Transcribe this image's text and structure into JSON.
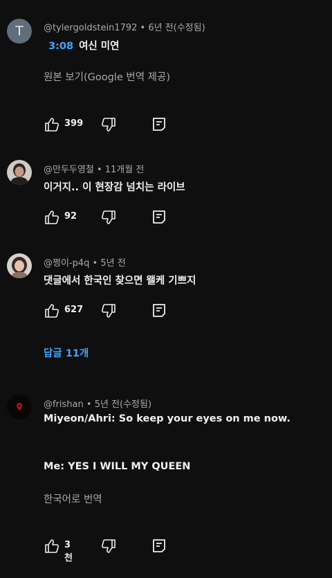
{
  "comments": [
    {
      "avatar_letter": "T",
      "author": "@tylergoldstein1792",
      "age": "6년 전(수정됨)",
      "timestamp": "3:08",
      "text": "여신 미연",
      "subtext": "원본 보기(Google 번역 제공)",
      "likes": "399"
    },
    {
      "author": "@만두두영철",
      "age": "11개월 전",
      "text": "이거지.. 이 현장감 넘치는 라이브",
      "likes": "92"
    },
    {
      "author": "@쩡이-p4q",
      "age": "5년 전",
      "text": "댓글에서 한국인 찾으면 왤케 기쁘지",
      "likes": "627",
      "replies_label": "답글 11개"
    },
    {
      "author": "@frishan",
      "age": "5년 전(수정됨)",
      "text": "Miyeon/Ahri: So keep your eyes on me now.",
      "text2": "Me: YES I WILL MY QUEEN",
      "subtext": "한국어로 번역",
      "likes": "3천"
    }
  ],
  "separator": " • ",
  "icons": {
    "like": "thumbs-up-icon",
    "dislike": "thumbs-down-icon",
    "reply": "reply-icon"
  },
  "colors": {
    "background": "#0f0f0f",
    "text": "#f1f1f1",
    "secondary": "#aaaaaa",
    "link": "#3ea6ff"
  }
}
